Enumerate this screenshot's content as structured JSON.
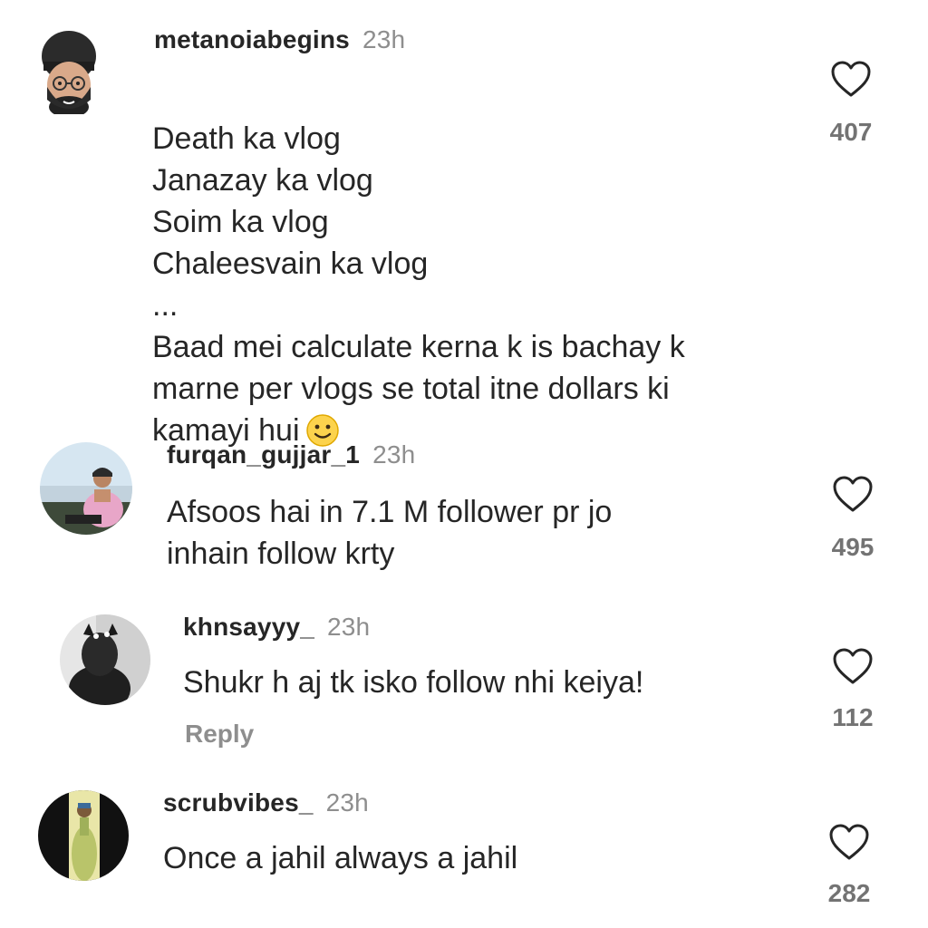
{
  "comments": [
    {
      "username": "metanoiabegins",
      "time": "23h",
      "text": "Death ka vlog\nJanazay ka vlog\nSoim ka vlog\nChaleesvain ka vlog\n...\nBaad mei calculate kerna k is bachay k\nmarne per vlogs se total itne dollars ki\nkamayi hui",
      "emoji": "slightly-smiling-face-icon",
      "likes": "407"
    },
    {
      "username": "furqan_gujjar_1",
      "time": "23h",
      "text": "Afsoos hai in 7.1 M follower pr jo\ninhain follow krty",
      "likes": "495"
    },
    {
      "username": "khnsayyy_",
      "time": "23h",
      "text": "Shukr h aj tk isko follow nhi keiya!",
      "reply_label": "Reply",
      "likes": "112"
    },
    {
      "username": "scrubvibes_",
      "time": "23h",
      "text": "Once a jahil always a jahil",
      "likes": "282"
    }
  ],
  "icons": {
    "like": "heart-outline-icon"
  },
  "colors": {
    "text": "#262626",
    "muted": "#8e8e8e"
  }
}
